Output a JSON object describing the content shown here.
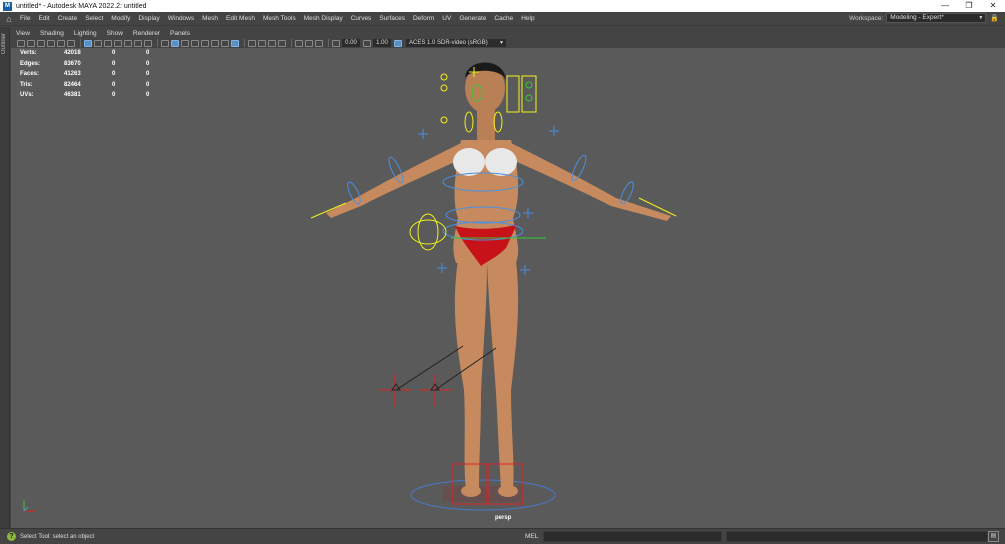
{
  "window": {
    "title": "untitled* - Autodesk MAYA 2022.2: untitled",
    "app_icon": "maya-icon",
    "controls": [
      "—",
      "❐",
      "✕"
    ]
  },
  "menubar": {
    "items": [
      "File",
      "Edit",
      "Create",
      "Select",
      "Modify",
      "Display",
      "Windows",
      "Mesh",
      "Edit Mesh",
      "Mesh Tools",
      "Mesh Display",
      "Curves",
      "Surfaces",
      "Deform",
      "UV",
      "Generate",
      "Cache",
      "Help"
    ],
    "workspace_label": "Workspace:",
    "workspace_value": "Modeling - Expert*"
  },
  "outliner": {
    "label": "Outliner"
  },
  "panel_menu": {
    "items": [
      "View",
      "Shading",
      "Lighting",
      "Show",
      "Renderer",
      "Panels"
    ]
  },
  "panel_toolbar": {
    "exposure": "0.00",
    "gamma": "1.00",
    "color_space": "ACES 1.0 SDR-video (sRGB)"
  },
  "hud": {
    "rows": [
      {
        "label": "Verts:",
        "value": "42018",
        "sel": "0",
        "tri": "0"
      },
      {
        "label": "Edges:",
        "value": "83670",
        "sel": "0",
        "tri": "0"
      },
      {
        "label": "Faces:",
        "value": "41263",
        "sel": "0",
        "tri": "0"
      },
      {
        "label": "Tris:",
        "value": "82464",
        "sel": "0",
        "tri": "0"
      },
      {
        "label": "UVs:",
        "value": "46381",
        "sel": "0",
        "tri": "0"
      }
    ]
  },
  "viewport": {
    "camera_label": "persp"
  },
  "status": {
    "help_text": "Select Tool: select an object",
    "mel_label": "MEL"
  },
  "colors": {
    "viewport_bg": "#5a5a5a",
    "skin": "#c78a5e",
    "bikini_top": "#e8e8e8",
    "bikini_bottom": "#c8121a",
    "ctrl_yellow": "#f2f21a",
    "ctrl_blue": "#4a90e2",
    "ctrl_red": "#e02020"
  }
}
